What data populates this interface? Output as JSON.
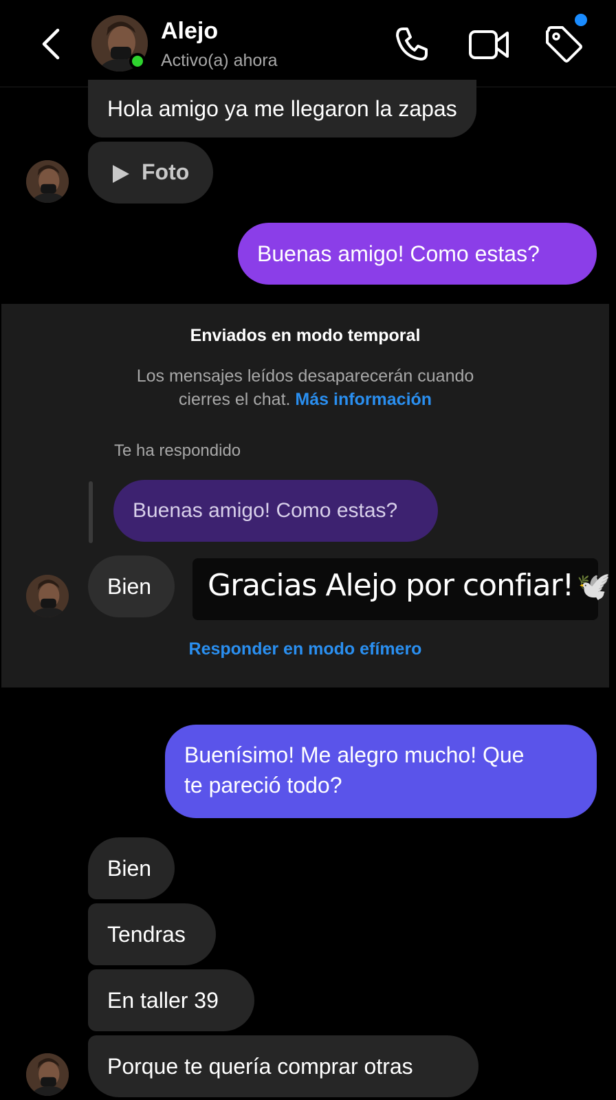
{
  "header": {
    "name": "Alejo",
    "status": "Activo(a) ahora"
  },
  "messages_top": [
    {
      "text": "Hola amigo ya me llegaron la zapas"
    },
    {
      "text": "Foto"
    },
    {
      "text": "Buenas amigo! Como estas?"
    }
  ],
  "ephemeral": {
    "title": "Enviados en modo temporal",
    "desc_line1": "Los mensajes leídos desaparecerán cuando",
    "desc_line2": "cierres el chat.",
    "more_info": "Más información",
    "replied_label": "Te ha respondido",
    "quoted": "Buenas amigo! Como estas?",
    "reply": "Bien",
    "overlay": "Gracias Alejo por confiar!",
    "overlay_emoji": "🕊️",
    "respond_link": "Responder en modo efímero"
  },
  "messages_bottom": [
    {
      "line1": "Buenísimo! Me alegro mucho! Que",
      "line2": "te pareció todo?"
    },
    {
      "text": "Bien"
    },
    {
      "text": "Tendras"
    },
    {
      "text": "En taller 39"
    },
    {
      "text": "Porque te quería comprar otras"
    }
  ],
  "colors": {
    "outgoing_purple": "#8b3ee8",
    "outgoing_indigo": "#5a54ea",
    "incoming": "#262626",
    "link": "#2a8ff0",
    "online": "#2ed32e",
    "notification": "#1a8cff"
  },
  "icons": [
    "back-chevron-icon",
    "phone-icon",
    "video-camera-icon",
    "tag-icon",
    "play-icon"
  ]
}
